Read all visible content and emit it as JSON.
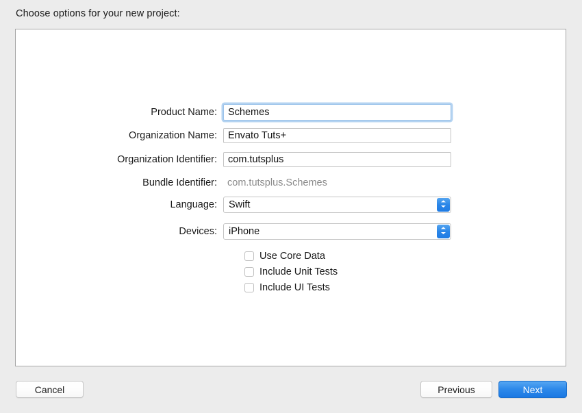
{
  "dialog": {
    "prompt": "Choose options for your new project:"
  },
  "form": {
    "fields": [
      {
        "label": "Product Name:",
        "value": "Schemes",
        "type": "text",
        "focused": true
      },
      {
        "label": "Organization Name:",
        "value": "Envato Tuts+",
        "type": "text",
        "focused": false
      },
      {
        "label": "Organization Identifier:",
        "value": "com.tutsplus",
        "type": "text",
        "focused": false
      },
      {
        "label": "Bundle Identifier:",
        "value": "com.tutsplus.Schemes",
        "type": "static",
        "focused": false
      },
      {
        "label": "Language:",
        "value": "Swift",
        "type": "popup",
        "focused": false
      },
      {
        "label": "Devices:",
        "value": "iPhone",
        "type": "popup",
        "focused": false
      }
    ],
    "checkboxes": [
      {
        "label": "Use Core Data",
        "checked": false
      },
      {
        "label": "Include Unit Tests",
        "checked": false
      },
      {
        "label": "Include UI Tests",
        "checked": false
      }
    ]
  },
  "buttons": {
    "cancel": "Cancel",
    "previous": "Previous",
    "next": "Next"
  },
  "colors": {
    "accent": "#2d89ea",
    "window_bg": "#ececec",
    "panel_bg": "#ffffff",
    "static_text": "#8b8b8b"
  },
  "icons": {
    "popup_arrows": "chevron-up-down-icon",
    "checkbox": "checkbox-unchecked-icon"
  }
}
